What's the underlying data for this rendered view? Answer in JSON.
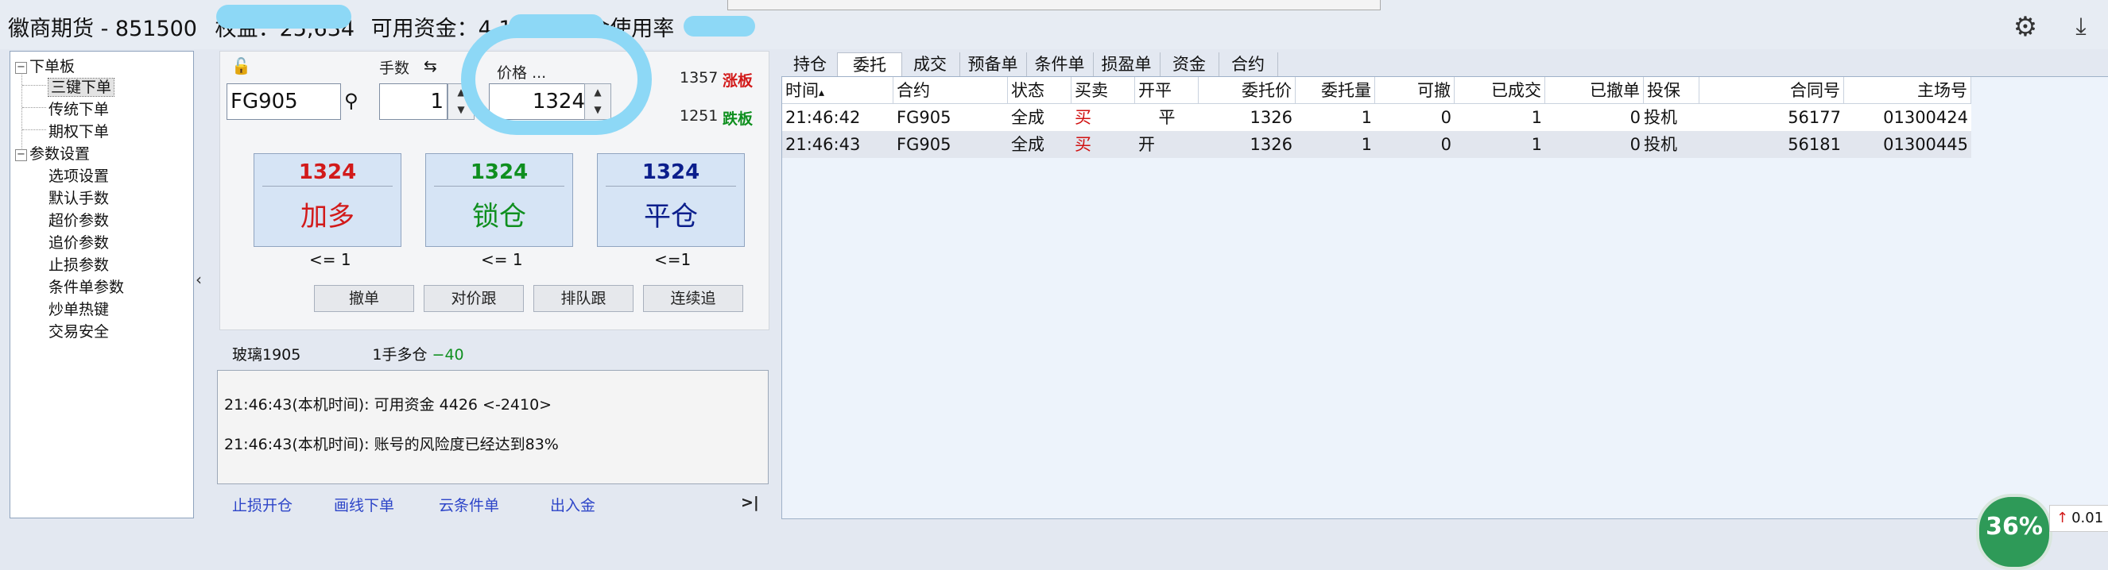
{
  "window": {
    "title": "徽商期货 - 851500  权益：25,634，可用资金：4,1… 资金使用率…",
    "title_prefix": "徽商期货 - 851500",
    "title_equity_label": "权益：",
    "title_equity": "25,634",
    "title_funds_label": "可用资金：",
    "title_funds": "4,1",
    "title_usage": "资金使用率"
  },
  "tree": {
    "groups": [
      {
        "label": "下单板",
        "toggle": "−",
        "children": [
          "三键下单",
          "传统下单",
          "期权下单"
        ]
      },
      {
        "label": "参数设置",
        "toggle": "−",
        "children": [
          "选项设置",
          "默认手数",
          "超价参数",
          "追价参数",
          "止损参数",
          "条件单参数",
          "炒单热键",
          "交易安全"
        ]
      }
    ],
    "selected": "三键下单"
  },
  "order": {
    "lots_label": "手数",
    "price_label": "价格",
    "price_more": "...",
    "contract": "FG905",
    "lots": "1",
    "price": "1324",
    "limit_up": "1357",
    "limit_up_label": "涨板",
    "limit_down": "1251",
    "limit_down_label": "跌板",
    "buttons": [
      {
        "price": "1324",
        "label": "加多",
        "note": "<= 1",
        "color": "#d21a1a"
      },
      {
        "price": "1324",
        "label": "锁仓",
        "note": "<= 1",
        "color": "#0f8f1f"
      },
      {
        "price": "1324",
        "label": "平仓",
        "note": "<=1",
        "color": "#0b1e8c"
      }
    ],
    "small_buttons": [
      "撤单",
      "对价跟",
      "排队跟",
      "连续追"
    ]
  },
  "position": {
    "name": "玻璃1905",
    "desc": "1手多仓",
    "pnl": "−40"
  },
  "messages": [
    {
      "time": "21:46:43",
      "src": "(本机时间):",
      "text": " 可用资金 4426  <-2410>"
    },
    {
      "time": "21:46:43",
      "src": "(本机时间):",
      "text": " 账号的风险度已经达到83%"
    }
  ],
  "bottom_links": [
    "止损开仓",
    "画线下单",
    "云条件单",
    "出入金"
  ],
  "bottom_more": ">|",
  "tabs": [
    "持仓",
    "委托",
    "成交",
    "预备单",
    "条件单",
    "损盈单",
    "资金",
    "合约"
  ],
  "active_tab": "委托",
  "grid": {
    "headers": [
      "时间",
      "合约",
      "状态",
      "买卖",
      "开平",
      "委托价",
      "委托量",
      "可撤",
      "已成交",
      "已撤单",
      "投保",
      "合同号",
      "主场号"
    ],
    "sort_mark": "▴",
    "rows": [
      [
        "21:46:42",
        "FG905",
        "全成",
        "买",
        "平",
        "1326",
        "1",
        "0",
        "1",
        "0",
        "投机",
        "56177",
        "01300424"
      ],
      [
        "21:46:43",
        "FG905",
        "全成",
        "买",
        "开",
        "1326",
        "1",
        "0",
        "1",
        "0",
        "投机",
        "56181",
        "01300445"
      ]
    ]
  },
  "status": {
    "percent": "36%",
    "speed": "0.01"
  },
  "colors": {
    "accent_blue": "#2d45c8",
    "red": "#d21a1a",
    "green": "#0f8f1f",
    "navy": "#0b1e8c",
    "scribble": "#8dd8f6"
  }
}
